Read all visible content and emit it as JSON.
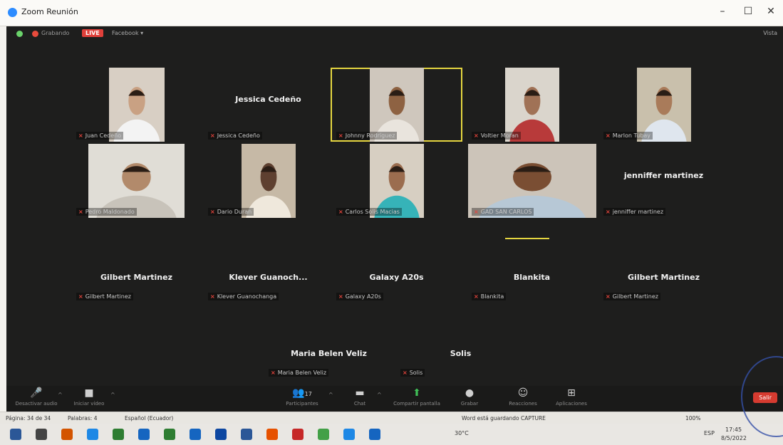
{
  "window": {
    "title": "Zoom Reunión",
    "minimize": "–",
    "maximize": "☐",
    "close": "✕"
  },
  "topbar": {
    "recording": "Grabando",
    "live": "LIVE",
    "facebook": "Facebook ▾",
    "view": "Vista"
  },
  "participants": [
    {
      "display": "",
      "label": "Juan Cedeño",
      "video": true,
      "skin": "#c9a183",
      "shirt": "#f3f3f3",
      "bg": "#d8cfc4"
    },
    {
      "display": "Jessica Cedeño",
      "label": "Jessica Cedeño",
      "video": false
    },
    {
      "display": "",
      "label": "Johnny Rodríguez",
      "video": true,
      "active": true,
      "skin": "#8e6242",
      "shirt": "#e9e4dd",
      "bg": "#cfc7bd"
    },
    {
      "display": "",
      "label": "Voltier Moran",
      "video": true,
      "skin": "#a07256",
      "shirt": "#b83a3a",
      "bg": "#dad5cc"
    },
    {
      "display": "",
      "label": "Marlon Tubay",
      "video": true,
      "skin": "#a97b5a",
      "shirt": "#dfe6ee",
      "bg": "#c9c0ac"
    },
    {
      "display": "",
      "label": "Pedro Maldonado",
      "video": true,
      "skin": "#b28a6b",
      "shirt": "#c8c3ba",
      "bg": "#e0ddd6"
    },
    {
      "display": "",
      "label": "Dario Duran",
      "video": true,
      "skin": "#5e4030",
      "shirt": "#efe8dc",
      "bg": "#c6b9a6"
    },
    {
      "display": "",
      "label": "Carlos Solis Macias",
      "video": true,
      "skin": "#9b6d4f",
      "shirt": "#36b3b8",
      "bg": "#d7cfc2"
    },
    {
      "display": "",
      "label": "GAD SAN CARLOS",
      "video": true,
      "skin": "#7a4e33",
      "shirt": "#b7c8d6",
      "bg": "#ccc4b9"
    },
    {
      "display": "jenniffer martinez",
      "label": "jenniffer martinez",
      "video": false
    },
    {
      "display": "Gilbert Martinez",
      "label": "Gilbert Martinez",
      "video": false
    },
    {
      "display": "Klever Guanoch...",
      "label": "Klever Guanochanga",
      "video": false
    },
    {
      "display": "Galaxy A20s",
      "label": "Galaxy A20s",
      "video": false
    },
    {
      "display": "Blankita",
      "label": "Blankita",
      "video": false
    },
    {
      "display": "Gilbert Martinez",
      "label": "Gilbert Martinez",
      "video": false
    },
    {
      "display": "Maria Belen Veliz",
      "label": "Maria Belen Veliz",
      "video": false
    },
    {
      "display": "Solis",
      "label": "Solis",
      "video": false
    }
  ],
  "toolbar": {
    "unmute": "Desactivar audio",
    "video": "Iniciar vídeo",
    "participants": "Participantes",
    "participants_count": "17",
    "chat": "Chat",
    "share": "Compartir pantalla",
    "record": "Grabar",
    "reactions": "Reacciones",
    "apps": "Aplicaciones",
    "end": "Salir"
  },
  "wordbar": {
    "page": "Página: 34 de 34",
    "words": "Palabras: 4",
    "lang": "Español (Ecuador)",
    "saving": "Word está guardando CAPTURE",
    "zoom": "100%"
  },
  "taskbar": {
    "temp": "30°C",
    "lang": "ESP",
    "time": "17:45",
    "date": "8/5/2022"
  }
}
